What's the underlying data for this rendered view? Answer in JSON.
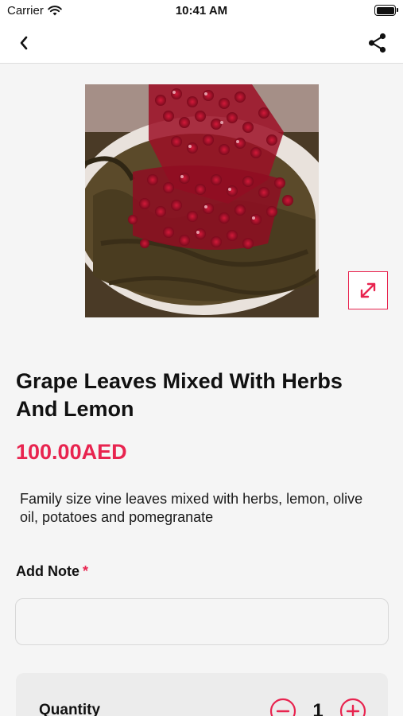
{
  "status_bar": {
    "carrier": "Carrier",
    "time": "10:41 AM"
  },
  "nav": {
    "back_icon": "chevron-left-icon",
    "share_icon": "share-icon"
  },
  "product": {
    "image_description_icon": "product-photo",
    "title": "Grape Leaves Mixed With Herbs And Lemon",
    "price": "100.00AED",
    "description": "Family size vine leaves mixed with herbs, lemon, olive oil, potatoes and pomegranate"
  },
  "note": {
    "label": "Add Note",
    "required_marker": "*",
    "value": "",
    "placeholder": ""
  },
  "quantity": {
    "label": "Quantity",
    "value": "1"
  },
  "colors": {
    "accent": "#e8244f",
    "background": "#f5f5f5",
    "card": "#ececec"
  }
}
